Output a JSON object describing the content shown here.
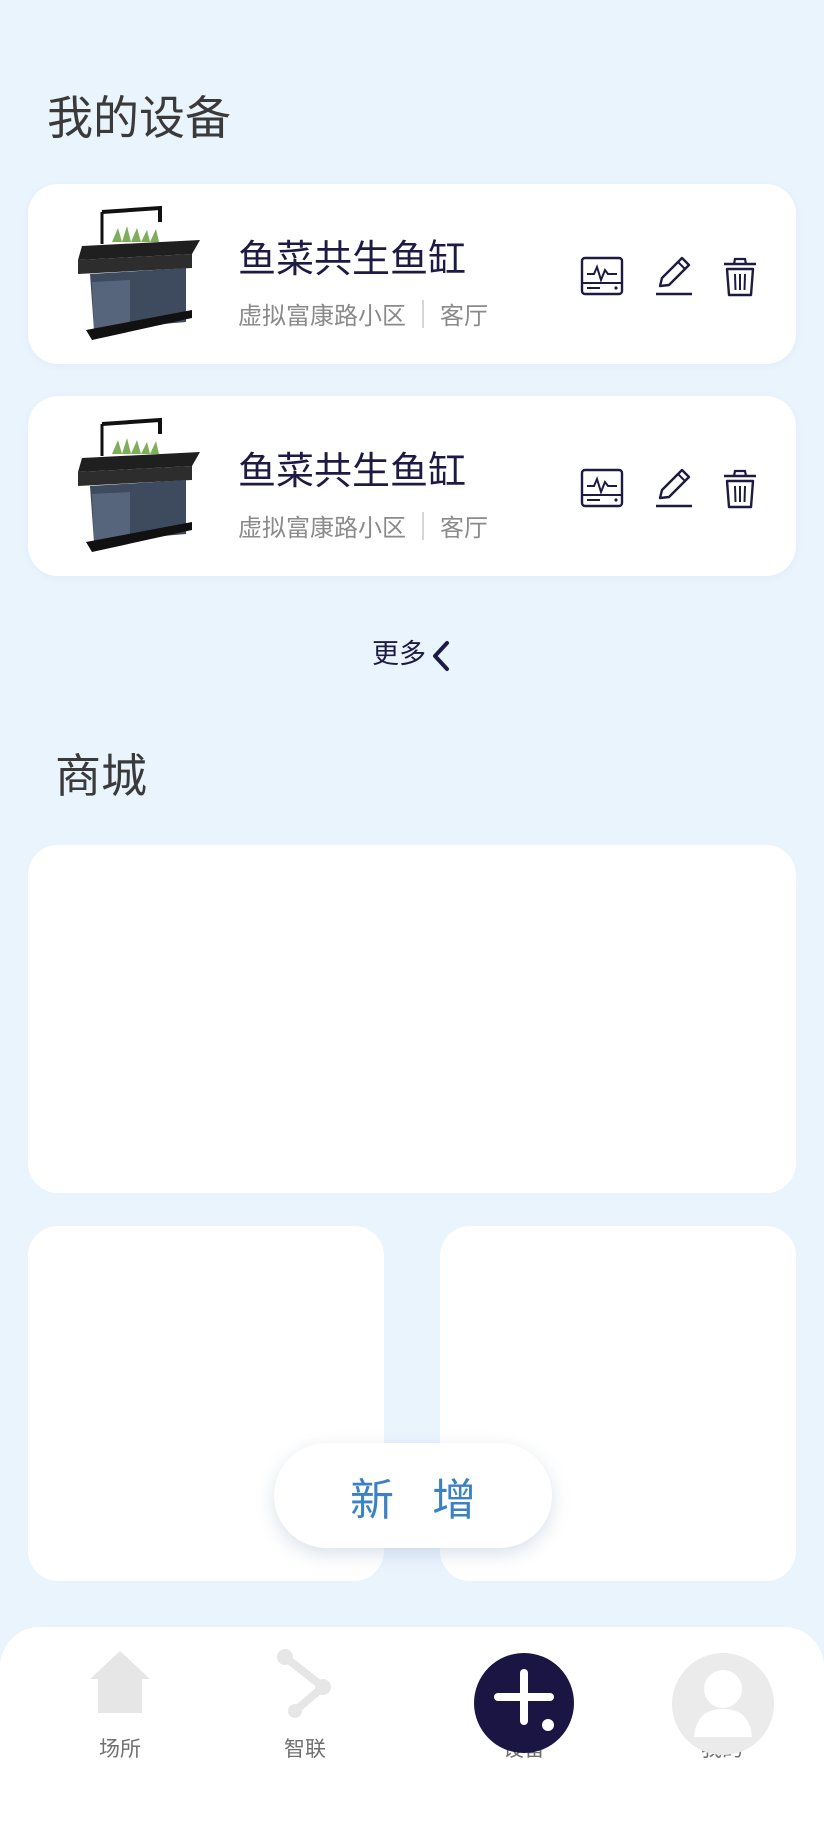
{
  "devices_section": {
    "title": "我的设备"
  },
  "devices": [
    {
      "name": "鱼菜共生鱼缸",
      "community": "虚拟富康路小区",
      "room": "客厅"
    },
    {
      "name": "鱼菜共生鱼缸",
      "community": "虚拟富康路小区",
      "room": "客厅"
    }
  ],
  "more": {
    "label": "更多"
  },
  "mall_section": {
    "title": "商城"
  },
  "fab": {
    "label": "新增"
  },
  "tabbar": {
    "items": [
      {
        "label": "场所",
        "icon": "home-icon"
      },
      {
        "label": "智联",
        "icon": "link-nodes-icon"
      },
      {
        "label": "设备",
        "icon": "plus-icon"
      },
      {
        "label": "我的",
        "icon": "user-avatar-icon"
      }
    ]
  },
  "colors": {
    "background": "#eaf4fd",
    "accent_dark": "#1d1a44",
    "add_text": "#3b82c4"
  }
}
